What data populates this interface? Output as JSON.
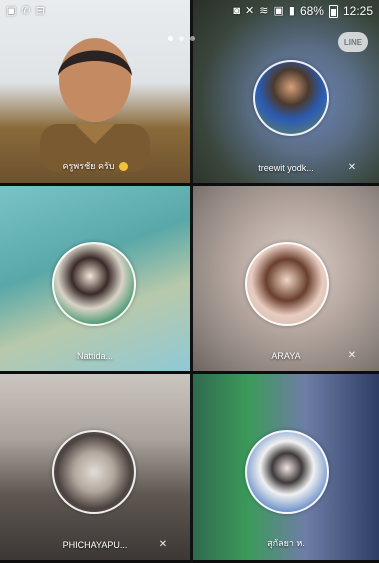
{
  "status_bar": {
    "battery": "68%",
    "time": "12:25"
  },
  "brand": {
    "logo_text": "LINE"
  },
  "participants": [
    {
      "name": "ครูพรชัย ครับ",
      "emoji": "😊"
    },
    {
      "name": "treewit yodk..."
    },
    {
      "name": "Nattida..."
    },
    {
      "name": "ARAYA"
    },
    {
      "name": "PHICHAYAPU..."
    },
    {
      "name": "สุกัลยา ห."
    }
  ]
}
